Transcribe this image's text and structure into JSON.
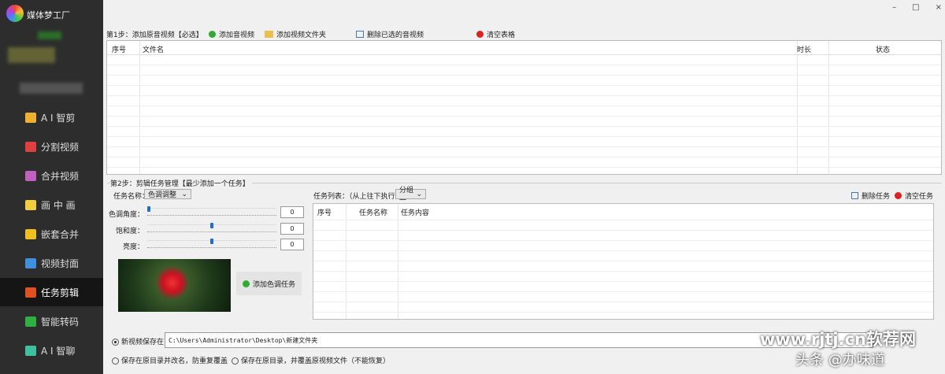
{
  "app": {
    "name": "媒体梦工厂"
  },
  "window": {
    "minimize": "–",
    "maximize": "□",
    "close": "×"
  },
  "sidebar": {
    "items": [
      {
        "label": "A I 智剪",
        "color": "#f0b030"
      },
      {
        "label": "分割视频",
        "color": "#e04040"
      },
      {
        "label": "合并视频",
        "color": "#c060c0"
      },
      {
        "label": "画 中 画",
        "color": "#f0d040"
      },
      {
        "label": "嵌套合并",
        "color": "#f0c020"
      },
      {
        "label": "视频封面",
        "color": "#4090e0"
      },
      {
        "label": "任务剪辑",
        "color": "#e05020",
        "selected": true
      },
      {
        "label": "智能转码",
        "color": "#30b040"
      },
      {
        "label": "A I 智聊",
        "color": "#40c0a0"
      }
    ]
  },
  "step1": {
    "label": "第1步：添加原音视频【必选】",
    "add_media": "添加音视频",
    "add_folder": "添加视频文件夹",
    "delete_selected": "删除已选的音视频",
    "clear_table": "清空表格",
    "columns": [
      "序号",
      "文件名",
      "时长",
      "状态"
    ]
  },
  "step2": {
    "label": "第2步：剪辑任务管理【最少添加一个任务】",
    "task_name_label": "任务名称：",
    "task_name_value": "色调调整",
    "sliders": [
      {
        "label": "色调角度：",
        "value": "0",
        "position": 0
      },
      {
        "label": "饱和度：",
        "value": "0",
        "position": 0.5
      },
      {
        "label": "亮度：",
        "value": "0",
        "position": 0.5
      }
    ],
    "add_task": "添加色调任务",
    "task_list_label": "任务列表：（从上往下执行）",
    "group_value": "分组一",
    "delete_task": "删除任务",
    "clear_tasks": "清空任务",
    "columns": [
      "序号",
      "任务名称",
      "任务内容"
    ]
  },
  "output": {
    "new_path_label": "新视频保存在：",
    "path": "C:\\Users\\Administrator\\Desktop\\新建文件夹",
    "rename_label": "保存在原目录并改名，防重复覆盖",
    "overwrite_label": "保存在原目录，并覆盖原视频文件（不能恢复）"
  },
  "watermark": {
    "text1": "www.rjtj.cn软荐网",
    "text2": "头条 @办味道"
  }
}
